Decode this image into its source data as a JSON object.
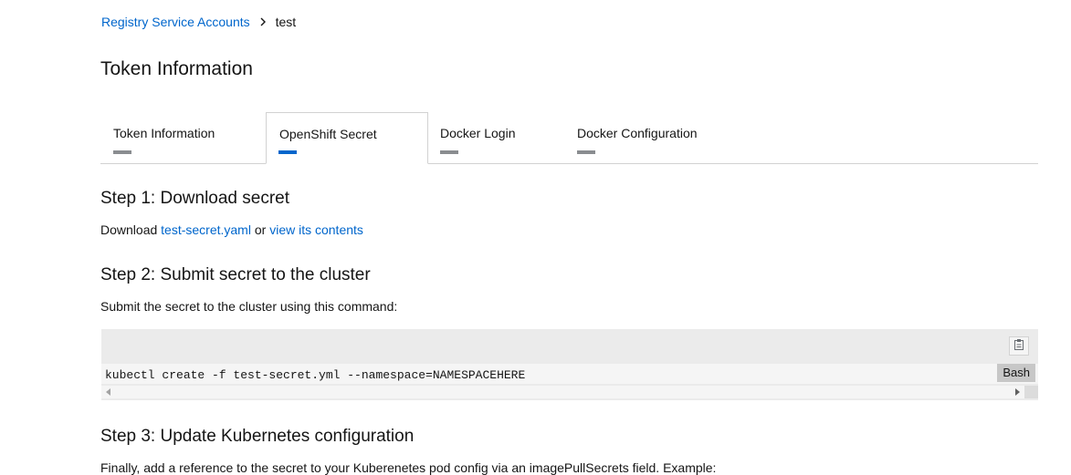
{
  "breadcrumb": {
    "parent": "Registry Service Accounts",
    "current": "test"
  },
  "page_title": "Token Information",
  "tabs": [
    {
      "label": "Token Information",
      "active": false
    },
    {
      "label": "OpenShift Secret",
      "active": true
    },
    {
      "label": "Docker Login",
      "active": false
    },
    {
      "label": "Docker Configuration",
      "active": false
    }
  ],
  "step1": {
    "title": "Step 1: Download secret",
    "prefix": "Download ",
    "file_link": "test-secret.yaml",
    "or": " or ",
    "view_link": "view its contents"
  },
  "step2": {
    "title": "Step 2: Submit secret to the cluster",
    "description": "Submit the secret to the cluster using this command:",
    "command": "kubectl create -f test-secret.yml --namespace=NAMESPACEHERE",
    "language": "Bash"
  },
  "step3": {
    "title": "Step 3: Update Kubernetes configuration",
    "description": "Finally, add a reference to the secret to your Kuberenetes pod config via an imagePullSecrets field. Example:"
  },
  "icons": {
    "breadcrumb_separator": "chevron-right-icon",
    "copy": "clipboard-icon"
  },
  "colors": {
    "link": "#0066cc",
    "active_tab_indicator": "#0066cc",
    "inactive_tab_indicator": "#8a8d90"
  }
}
